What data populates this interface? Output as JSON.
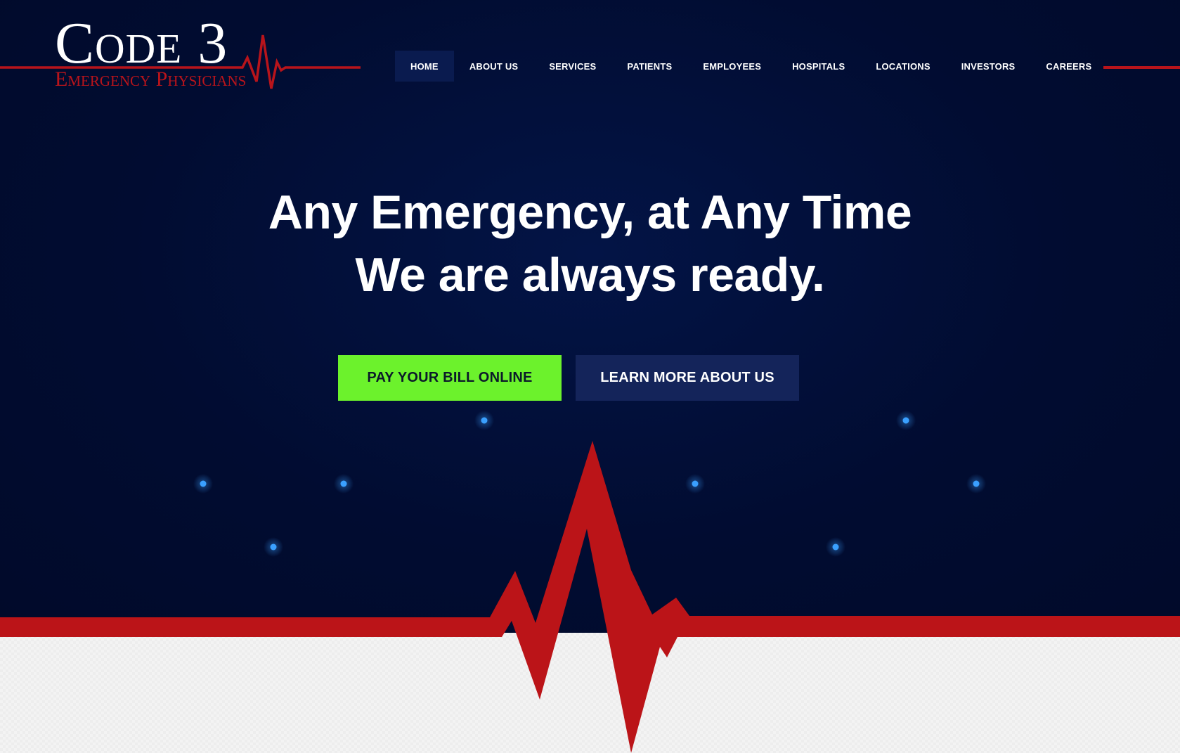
{
  "brand": {
    "title": "Code 3",
    "subtitle": "Emergency Physicians",
    "title_color": "#ffffff",
    "subtitle_color": "#b8141b"
  },
  "nav": {
    "items": [
      {
        "label": "HOME",
        "active": true
      },
      {
        "label": "ABOUT US",
        "active": false
      },
      {
        "label": "SERVICES",
        "active": false
      },
      {
        "label": "PATIENTS",
        "active": false
      },
      {
        "label": "EMPLOYEES",
        "active": false
      },
      {
        "label": "HOSPITALS",
        "active": false
      },
      {
        "label": "LOCATIONS",
        "active": false
      },
      {
        "label": "INVESTORS",
        "active": false
      },
      {
        "label": "CAREERS",
        "active": false
      }
    ]
  },
  "hero": {
    "headline_line1": "Any Emergency, at Any Time",
    "headline_line2": "We are always ready.",
    "pay_button": "PAY YOUR BILL ONLINE",
    "learn_button": "LEARN MORE ABOUT US"
  },
  "colors": {
    "background": "#010c2f",
    "accent_red": "#bb1418",
    "pay_button": "#6cf22c",
    "learn_button": "#14245a",
    "grid_line": "#1d3a8a",
    "grid_dot": "#3aa0ff",
    "band": "#f3f3f3"
  },
  "icons": {
    "heartbeat": "heartbeat-line-icon",
    "logo_heartbeat": "logo-ekg-icon"
  }
}
